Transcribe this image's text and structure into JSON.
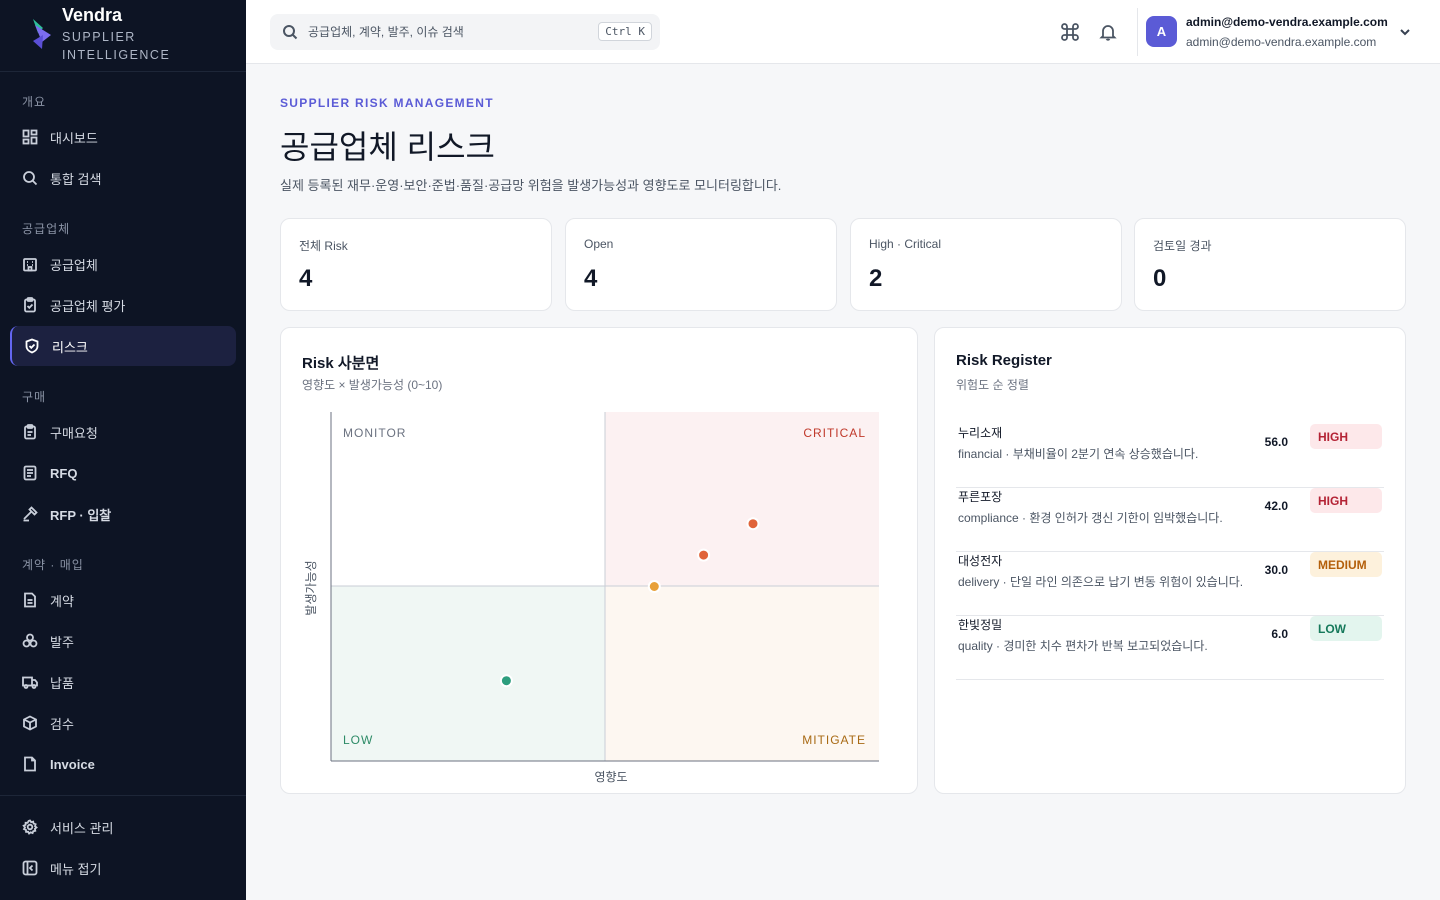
{
  "brand": {
    "name": "Vendra",
    "subtitle": "SUPPLIER INTELLIGENCE"
  },
  "sidebar": {
    "sections": [
      {
        "label": "개요"
      },
      {
        "label": "공급업체"
      },
      {
        "label": "구매"
      },
      {
        "label": "계약 · 매입"
      }
    ],
    "items": [
      {
        "label": "대시보드",
        "icon": "dashboard-icon"
      },
      {
        "label": "통합 검색",
        "icon": "search-icon"
      },
      {
        "label": "공급업체",
        "icon": "building-icon"
      },
      {
        "label": "공급업체 평가",
        "icon": "clipboard-check-icon"
      },
      {
        "label": "리스크",
        "icon": "shield-check-icon",
        "active": true
      },
      {
        "label": "구매요청",
        "icon": "clipboard-icon"
      },
      {
        "label": "RFQ",
        "icon": "document-list-icon"
      },
      {
        "label": "RFP · 입찰",
        "icon": "gavel-icon"
      },
      {
        "label": "계약",
        "icon": "document-icon"
      },
      {
        "label": "발주",
        "icon": "boxes-icon"
      },
      {
        "label": "납품",
        "icon": "truck-icon"
      },
      {
        "label": "검수",
        "icon": "package-check-icon"
      },
      {
        "label": "Invoice",
        "icon": "invoice-icon"
      }
    ],
    "footer": [
      {
        "label": "서비스 관리",
        "icon": "gear-icon"
      },
      {
        "label": "메뉴 접기",
        "icon": "collapse-icon"
      }
    ]
  },
  "header": {
    "search_placeholder": "공급업체, 계약, 발주, 이슈 검색",
    "shortcut": "Ctrl K",
    "user_name": "admin@demo-vendra.example.com",
    "user_email": "admin@demo-vendra.example.com",
    "avatar_initial": "A"
  },
  "page": {
    "eyebrow": "SUPPLIER RISK MANAGEMENT",
    "title": "공급업체 리스크",
    "description": "실제 등록된 재무·운영·보안·준법·품질·공급망 위험을 발생가능성과 영향도로 모니터링합니다."
  },
  "stats": [
    {
      "label": "전체 Risk",
      "value": "4"
    },
    {
      "label": "Open",
      "value": "4"
    },
    {
      "label": "High · Critical",
      "value": "2"
    },
    {
      "label": "검토일 경과",
      "value": "0"
    }
  ],
  "quadrant": {
    "title": "Risk 사분면",
    "subtitle": "영향도 × 발생가능성 (0~10)",
    "x_label": "영향도",
    "y_label": "발생가능성",
    "labels": {
      "top_left": "MONITOR",
      "top_right": "CRITICAL",
      "bottom_left": "LOW",
      "bottom_right": "MITIGATE"
    },
    "colors": {
      "critical": "#e0643a",
      "medium": "#e8a13a",
      "low": "#2e9e7e"
    }
  },
  "chart_data": {
    "type": "scatter",
    "xlim": [
      0,
      10
    ],
    "ylim": [
      0,
      10
    ],
    "xlabel": "영향도",
    "ylabel": "발생가능성",
    "points": [
      {
        "supplier": "누리소재",
        "x": 7.7,
        "y": 6.8,
        "level": "HIGH"
      },
      {
        "supplier": "푸른포장",
        "x": 6.8,
        "y": 5.9,
        "level": "HIGH"
      },
      {
        "supplier": "대성전자",
        "x": 5.9,
        "y": 5.0,
        "level": "MEDIUM"
      },
      {
        "supplier": "한빛정밀",
        "x": 3.2,
        "y": 2.3,
        "level": "LOW"
      }
    ]
  },
  "register": {
    "title": "Risk Register",
    "subtitle": "위험도 순 정렬",
    "rows": [
      {
        "name": "누리소재",
        "desc": "financial · 부채비율이 2분기 연속 상승했습니다.",
        "score": "56.0",
        "level": "HIGH",
        "badge_bg": "#fde8ea",
        "badge_fg": "#b42335"
      },
      {
        "name": "푸른포장",
        "desc": "compliance · 환경 인허가 갱신 기한이 임박했습니다.",
        "score": "42.0",
        "level": "HIGH",
        "badge_bg": "#fde8ea",
        "badge_fg": "#b42335"
      },
      {
        "name": "대성전자",
        "desc": "delivery · 단일 라인 의존으로 납기 변동 위험이 있습니다.",
        "score": "30.0",
        "level": "MEDIUM",
        "badge_bg": "#fdf1dc",
        "badge_fg": "#b45f0a"
      },
      {
        "name": "한빛정밀",
        "desc": "quality · 경미한 치수 편차가 반복 보고되었습니다.",
        "score": "6.0",
        "level": "LOW",
        "badge_bg": "#e3f5ee",
        "badge_fg": "#16795b"
      }
    ]
  }
}
